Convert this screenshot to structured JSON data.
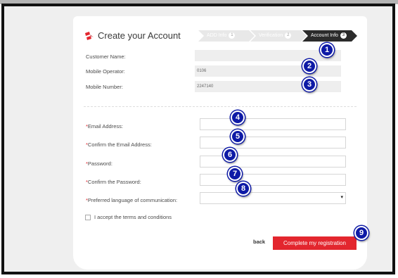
{
  "title": "Create your Account",
  "steps": [
    {
      "label": "ADD Info",
      "num": "1"
    },
    {
      "label": "Verification",
      "num": "2"
    },
    {
      "label": "Account Info",
      "num": "3"
    }
  ],
  "readonly_fields": [
    {
      "label": "Customer Name:",
      "value": ""
    },
    {
      "label": "Mobile Operator:",
      "value": "0106"
    },
    {
      "label": "Mobile Number:",
      "value": "2247140"
    }
  ],
  "form_fields": [
    {
      "required_mark": "*",
      "label": "Email Address:",
      "value": ""
    },
    {
      "required_mark": "*",
      "label": "Confirm the Email Address:",
      "value": ""
    },
    {
      "required_mark": "*",
      "label": "Password:",
      "value": ""
    },
    {
      "required_mark": "*",
      "label": "Confirm the Password:",
      "value": ""
    },
    {
      "required_mark": "*",
      "label": "Preferred language of communication:",
      "value": ""
    }
  ],
  "select_arrow": "▾",
  "terms_label": "I accept the terms and conditions",
  "back_label": "back",
  "submit_label": "Complete my registration",
  "markers": [
    "1",
    "2",
    "3",
    "4",
    "5",
    "6",
    "7",
    "8",
    "9"
  ],
  "colors": {
    "accent": "#e3262e",
    "marker": "#0e1aa6",
    "active_step": "#2b2b2b"
  },
  "icons": {
    "logo": "brand-logo-icon",
    "arrow": "chevron-down-icon",
    "checkbox": "checkbox-icon"
  }
}
